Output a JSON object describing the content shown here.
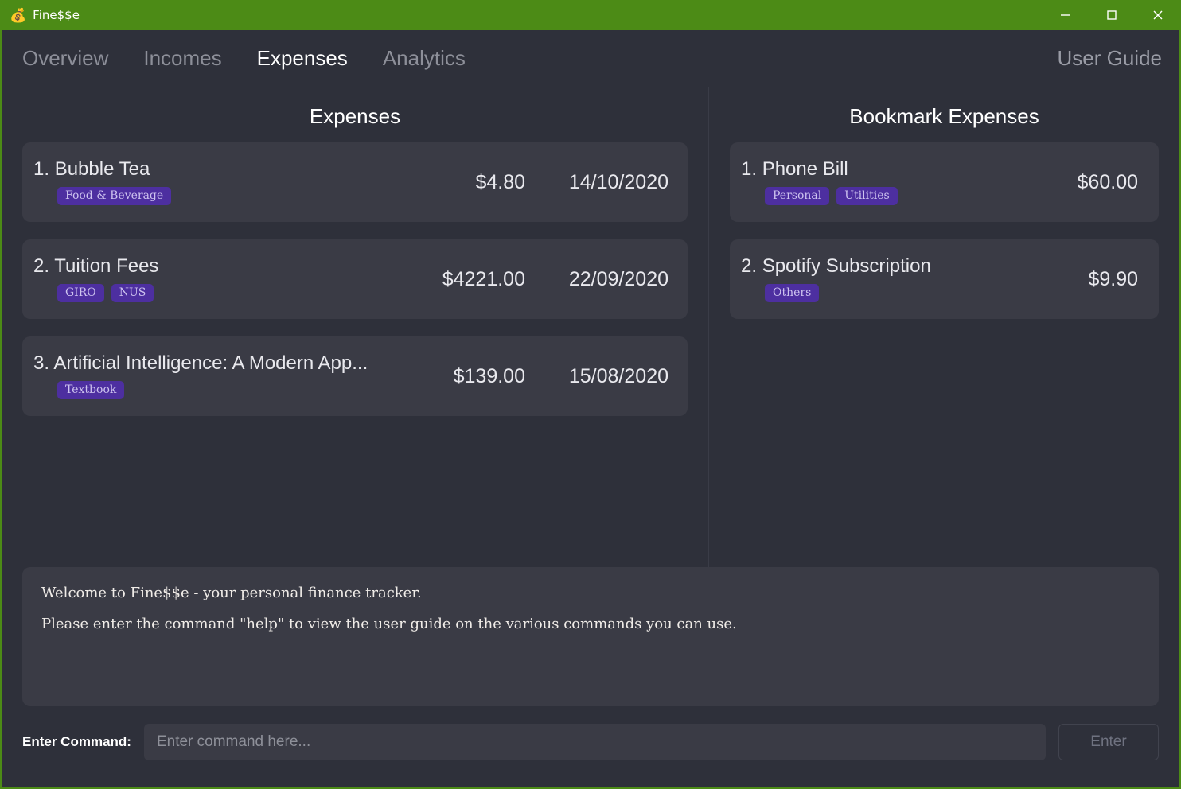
{
  "window": {
    "icon": "money-bag-icon",
    "title": "Fine$$e",
    "controls": {
      "minimize": "minimize-icon",
      "maximize": "maximize-icon",
      "close": "close-icon"
    }
  },
  "nav": {
    "tabs": [
      {
        "label": "Overview",
        "active": false
      },
      {
        "label": "Incomes",
        "active": false
      },
      {
        "label": "Expenses",
        "active": true
      },
      {
        "label": "Analytics",
        "active": false
      }
    ],
    "user_guide": "User Guide"
  },
  "expenses_panel": {
    "heading": "Expenses",
    "items": [
      {
        "index": "1.",
        "title": "Bubble Tea",
        "tags": [
          "Food & Beverage"
        ],
        "amount": "$4.80",
        "date": "14/10/2020"
      },
      {
        "index": "2.",
        "title": "Tuition Fees",
        "tags": [
          "GIRO",
          "NUS"
        ],
        "amount": "$4221.00",
        "date": "22/09/2020"
      },
      {
        "index": "3.",
        "title": "Artificial Intelligence: A Modern App...",
        "tags": [
          "Textbook"
        ],
        "amount": "$139.00",
        "date": "15/08/2020"
      }
    ]
  },
  "bookmark_panel": {
    "heading": "Bookmark Expenses",
    "items": [
      {
        "index": "1.",
        "title": "Phone Bill",
        "tags": [
          "Personal",
          "Utilities"
        ],
        "amount": "$60.00"
      },
      {
        "index": "2.",
        "title": "Spotify Subscription",
        "tags": [
          "Others"
        ],
        "amount": "$9.90"
      }
    ]
  },
  "result_box": {
    "lines": [
      "Welcome to Fine$$e - your personal finance tracker.",
      "Please enter the command \"help\" to view the user guide on the various commands you can use."
    ]
  },
  "command_bar": {
    "label": "Enter Command:",
    "input_value": "",
    "placeholder": "Enter command here...",
    "enter_label": "Enter"
  },
  "colors": {
    "titlebar_green": "#4c8b16",
    "app_background": "#2e303a",
    "card_background": "#3a3b45",
    "tag_purple": "#4d2fa0",
    "tag_text": "#cdc3ef",
    "active_tab": "#ffffff",
    "inactive_tab": "#8d8f99"
  }
}
